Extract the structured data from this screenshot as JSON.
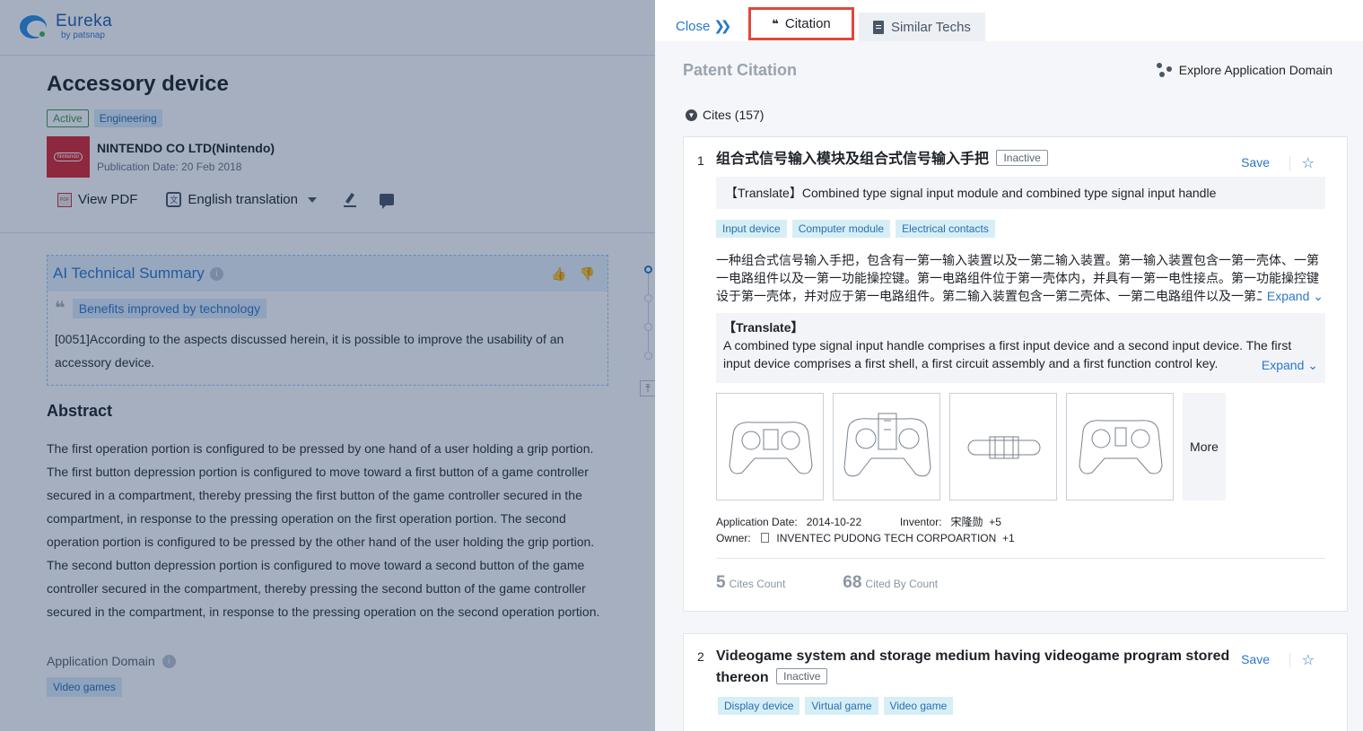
{
  "left": {
    "logo": {
      "title": "Eureka",
      "sub": "by patsnap"
    },
    "doc_title": "Accessory device",
    "tags": [
      "Active",
      "Engineering"
    ],
    "company": {
      "logo_text": "Nintendo",
      "name": "NINTENDO CO LTD(Nintendo)",
      "date": "Publication Date: 20 Feb 2018"
    },
    "tools": {
      "view_pdf": "View PDF",
      "pdf_icon": "PDF",
      "translation": "English translation"
    },
    "ai": {
      "title": "AI Technical Summary",
      "benefit": "Benefits improved by technology",
      "text": "[0051]According to the aspects discussed herein, it is possible to improve the usability of an accessory device."
    },
    "abstract": {
      "heading": "Abstract",
      "text": "The first operation portion is configured to be pressed by one hand of a user holding a grip portion. The first button depression portion is configured to move toward a first button of a game controller secured in a compartment, thereby pressing the first button of the game controller secured in the compartment, in response to the pressing operation on the first operation portion. The second operation portion is configured to be pressed by the other hand of the user holding the grip portion. The second button depression portion is configured to move toward a second button of the game controller secured in the compartment, thereby pressing the second button of the game controller secured in the compartment, in response to the pressing operation on the second operation portion."
    },
    "app_domain": {
      "label": "Application Domain",
      "tag": "Video games"
    }
  },
  "panel": {
    "close": "Close",
    "tabs": {
      "citation": "Citation",
      "similar": "Similar Techs"
    },
    "section_title": "Patent Citation",
    "explore": "Explore Application Domain",
    "cites": "Cites (157)",
    "cards": [
      {
        "num": "1",
        "title": "组合式信号输入模块及组合式信号输入手把",
        "status": "Inactive",
        "save": "Save",
        "translate_title": "【Translate】Combined type signal input module and combined type signal input handle",
        "tags": [
          "Input device",
          "Computer module",
          "Electrical contacts"
        ],
        "zh_abstract": "一种组合式信号输入手把，包含有一第一输入装置以及一第二输入装置。第一输入装置包含一第一壳体、一第一电路组件以及一第一功能操控键。第一电路组件位于第一壳体内，并具有一第一电性接点。第一功能操控键设于第一壳体，并对应于第一电路组件。第二输入装置包含一第二壳体、一第二电路组件以及一第二功能操控键。",
        "expand": "Expand",
        "en_label": "【Translate】",
        "en_abstract": "A combined type signal input handle comprises a first input device and a second input device. The first input device comprises a first shell, a first circuit assembly and a first function control key.",
        "more": "More",
        "app_date_label": "Application Date:",
        "app_date": "2014-10-22",
        "inventor_label": "Inventor:",
        "inventor": "宋隆勋",
        "inventor_more": "+5",
        "owner_label": "Owner:",
        "owner": "INVENTEC PUDONG TECH CORPOARTION",
        "owner_more": "+1",
        "cites_count": "5",
        "cites_label": "Cites Count",
        "cited_by": "68",
        "cited_by_label": "Cited By Count"
      },
      {
        "num": "2",
        "title": "Videogame system and storage medium having videogame program stored thereon",
        "status": "Inactive",
        "save": "Save",
        "tags": [
          "Display device",
          "Virtual game",
          "Video game"
        ]
      }
    ]
  }
}
